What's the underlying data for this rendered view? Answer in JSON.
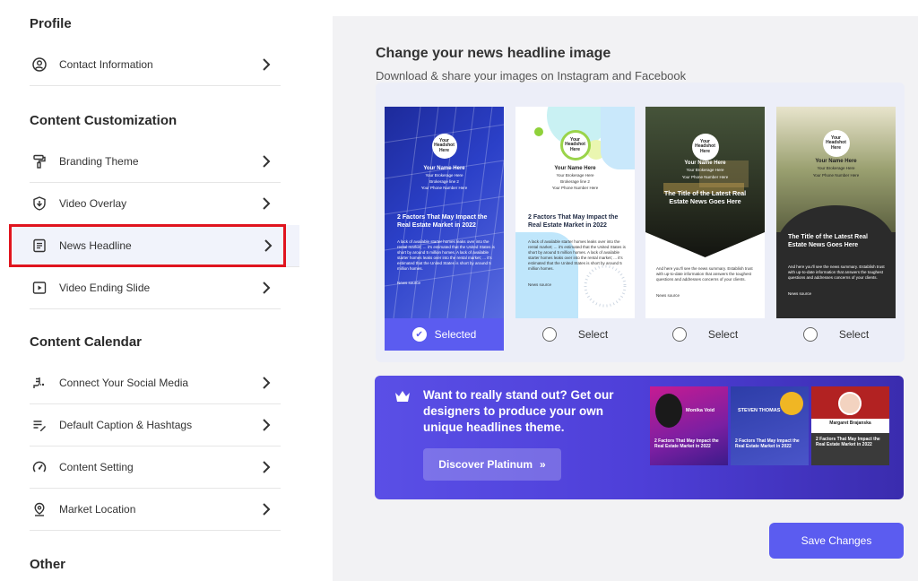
{
  "sidebar": {
    "profile_title": "Profile",
    "profile_items": [
      {
        "label": "Contact Information",
        "icon": "user-circle-icon"
      }
    ],
    "content_customization_title": "Content Customization",
    "customization_items": [
      {
        "label": "Branding Theme",
        "icon": "paint-roller-icon"
      },
      {
        "label": "Video Overlay",
        "icon": "shield-download-icon"
      },
      {
        "label": "News Headline",
        "icon": "document-icon",
        "active": true
      },
      {
        "label": "Video Ending Slide",
        "icon": "play-icon"
      }
    ],
    "content_calendar_title": "Content Calendar",
    "calendar_items": [
      {
        "label": "Connect Your Social Media",
        "icon": "plug-icon"
      },
      {
        "label": "Default Caption & Hashtags",
        "icon": "caption-pen-icon"
      },
      {
        "label": "Content Setting",
        "icon": "gauge-icon"
      },
      {
        "label": "Market Location",
        "icon": "location-pin-icon"
      }
    ],
    "other_title": "Other"
  },
  "main": {
    "title": "Change your news headline image",
    "subtitle": "Download & share your images on Instagram and Facebook",
    "templates": [
      {
        "headshot": "Your Headshot Here",
        "name": "Your Name Here",
        "brokerage": "Your Brokerage Here",
        "line2": "Brokerage line 2",
        "phone": "Your Phone Number Here",
        "headline": "2 Factors That May Impact the Real Estate Market in 2022",
        "body": "A lack of available starter homes leaks over into the rental market; ... it's estimated that the United States is short by around 5 million homes. A lack of available starter homes leaks over into the rental market; ... it's estimated that the United States is short by around 5 million homes.",
        "source": "News source",
        "status": "Selected",
        "selected": true
      },
      {
        "headshot": "Your Headshot Here",
        "name": "Your Name Here",
        "brokerage": "Your Brokerage Here",
        "line2": "Brokerage line 2",
        "phone": "Your Phone Number Here",
        "headline": "2 Factors That May Impact the Real Estate Market in 2022",
        "body": "A lack of available starter homes leaks over into the rental market; ... it's estimated that the United States is short by around 5 million homes. A lack of available starter homes leaks over into the rental market; ... it's estimated that the United States is short by around 5 million homes.",
        "source": "News source",
        "status": "Select",
        "selected": false
      },
      {
        "headshot": "Your Headshot Here",
        "name": "Your Name Here",
        "brokerage": "Your Brokerage Here",
        "phone": "Your Phone Number Here",
        "headline": "The Title of the Latest Real Estate News Goes Here",
        "body": "And here you'll see the news summary. Establish trust with up-to-date information that answers the toughest questions and addresses concerns of your clients.",
        "source": "News source",
        "status": "Select",
        "selected": false
      },
      {
        "headshot": "Your Headshot Here",
        "name": "Your Name Here",
        "brokerage": "Your Brokerage Here",
        "phone": "Your Phone Number Here",
        "headline": "The Title of the Latest Real Estate News Goes Here",
        "body": "And here you'll see the news summary. Establish trust with up-to-date information that answers the toughest questions and addresses concerns of your clients.",
        "source": "News source",
        "status": "Select",
        "selected": false
      }
    ],
    "promo": {
      "text": "Want to really stand out? Get our designers to produce your own unique headlines theme.",
      "button": "Discover Platinum",
      "button_icon": "double-chevron-right-icon",
      "samples": [
        {
          "name": "Monika Void",
          "headline": "2 Factors That May Impact the Real Estate Market in 2022"
        },
        {
          "name": "STEVEN THOMAS",
          "headline": "2 Factors That May Impact the Real Estate Market in 2022"
        },
        {
          "name": "Margaret Brajanska",
          "headline": "2 Factors That May Impact the Real Estate Market in 2022"
        }
      ]
    },
    "save": "Save Changes"
  },
  "colors": {
    "accent": "#5b5cf0",
    "highlight": "#e0141e",
    "panel": "#f2f2f4"
  }
}
